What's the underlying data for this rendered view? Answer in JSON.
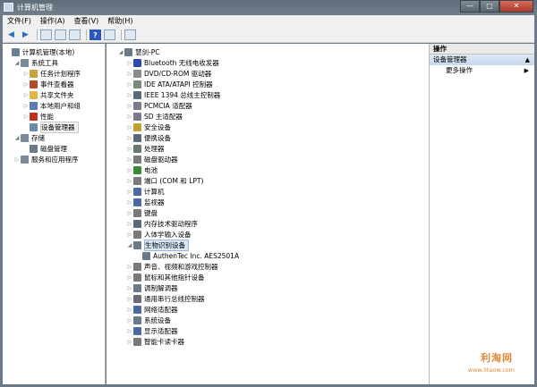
{
  "window": {
    "title": "计算机管理",
    "controls": [
      "—",
      "▢",
      "✕"
    ]
  },
  "menu": [
    "文件(F)",
    "操作(A)",
    "查看(V)",
    "帮助(H)"
  ],
  "left_tree": [
    {
      "label": "计算机管理(本地)",
      "level": 0,
      "exp": "",
      "color": "#6b7f96"
    },
    {
      "label": "系统工具",
      "level": 1,
      "exp": "◢",
      "color": "#7a8a9a"
    },
    {
      "label": "任务计划程序",
      "level": 2,
      "exp": "▷",
      "color": "#c9a43a"
    },
    {
      "label": "事件查看器",
      "level": 2,
      "exp": "▷",
      "color": "#b04a2a"
    },
    {
      "label": "共享文件夹",
      "level": 2,
      "exp": "▷",
      "color": "#e0b84a"
    },
    {
      "label": "本地用户和组",
      "level": 2,
      "exp": "▷",
      "color": "#5a7ab0"
    },
    {
      "label": "性能",
      "level": 2,
      "exp": "▷",
      "color": "#c03020"
    },
    {
      "label": "设备管理器",
      "level": 2,
      "exp": "",
      "color": "#6a8aa8",
      "selected": true
    },
    {
      "label": "存储",
      "level": 1,
      "exp": "◢",
      "color": "#7a8a9a"
    },
    {
      "label": "磁盘管理",
      "level": 2,
      "exp": "",
      "color": "#6a7a8a"
    },
    {
      "label": "服务和应用程序",
      "level": 1,
      "exp": "▷",
      "color": "#7a8a9a"
    }
  ],
  "device_tree": [
    {
      "label": "慧剑-PC",
      "level": 0,
      "exp": "◢",
      "color": "#6a7a8a"
    },
    {
      "label": "Bluetooth 无线电收发器",
      "level": 1,
      "exp": "▷",
      "color": "#2a4ab0"
    },
    {
      "label": "DVD/CD-ROM 驱动器",
      "level": 1,
      "exp": "▷",
      "color": "#8a8a8a"
    },
    {
      "label": "IDE ATA/ATAPI 控制器",
      "level": 1,
      "exp": "▷",
      "color": "#7a8a7a"
    },
    {
      "label": "IEEE 1394 总线主控制器",
      "level": 1,
      "exp": "▷",
      "color": "#5a6a7a"
    },
    {
      "label": "PCMCIA 适配器",
      "level": 1,
      "exp": "▷",
      "color": "#7a7a8a"
    },
    {
      "label": "SD 主适配器",
      "level": 1,
      "exp": "▷",
      "color": "#7a7a8a"
    },
    {
      "label": "安全设备",
      "level": 1,
      "exp": "▷",
      "color": "#c0a030"
    },
    {
      "label": "便携设备",
      "level": 1,
      "exp": "▷",
      "color": "#5a6a7a"
    },
    {
      "label": "处理器",
      "level": 1,
      "exp": "▷",
      "color": "#6a7a6a"
    },
    {
      "label": "磁盘驱动器",
      "level": 1,
      "exp": "▷",
      "color": "#7a7a7a"
    },
    {
      "label": "电池",
      "level": 1,
      "exp": "▷",
      "color": "#3a8a3a"
    },
    {
      "label": "端口 (COM 和 LPT)",
      "level": 1,
      "exp": "▷",
      "color": "#7a7a7a"
    },
    {
      "label": "计算机",
      "level": 1,
      "exp": "▷",
      "color": "#4a6aa0"
    },
    {
      "label": "监视器",
      "level": 1,
      "exp": "▷",
      "color": "#4a6aa0"
    },
    {
      "label": "键盘",
      "level": 1,
      "exp": "▷",
      "color": "#7a7a7a"
    },
    {
      "label": "内存技术驱动程序",
      "level": 1,
      "exp": "▷",
      "color": "#5a6a7a"
    },
    {
      "label": "人体学输入设备",
      "level": 1,
      "exp": "▷",
      "color": "#7a7a7a"
    },
    {
      "label": "生物识别设备",
      "level": 1,
      "exp": "◢",
      "color": "#6a7a8a",
      "selected": true
    },
    {
      "label": "AuthenTec Inc. AES2501A",
      "level": 2,
      "exp": "",
      "color": "#6a7a8a"
    },
    {
      "label": "声音、视频和游戏控制器",
      "level": 1,
      "exp": "▷",
      "color": "#7a7a7a"
    },
    {
      "label": "鼠标和其他指针设备",
      "level": 1,
      "exp": "▷",
      "color": "#7a7a7a"
    },
    {
      "label": "调制解调器",
      "level": 1,
      "exp": "▷",
      "color": "#6a7a8a"
    },
    {
      "label": "通用串行总线控制器",
      "level": 1,
      "exp": "▷",
      "color": "#6a6a7a"
    },
    {
      "label": "网络适配器",
      "level": 1,
      "exp": "▷",
      "color": "#4a6aa0"
    },
    {
      "label": "系统设备",
      "level": 1,
      "exp": "▷",
      "color": "#6a7a8a"
    },
    {
      "label": "显示适配器",
      "level": 1,
      "exp": "▷",
      "color": "#4a6aa0"
    },
    {
      "label": "智能卡读卡器",
      "level": 1,
      "exp": "▷",
      "color": "#7a7a7a"
    }
  ],
  "actions": {
    "header": "操作",
    "section": "设备管理器",
    "more": "更多操作"
  },
  "watermark": {
    "main": "利淘网",
    "sub": "www.litaow.com"
  }
}
